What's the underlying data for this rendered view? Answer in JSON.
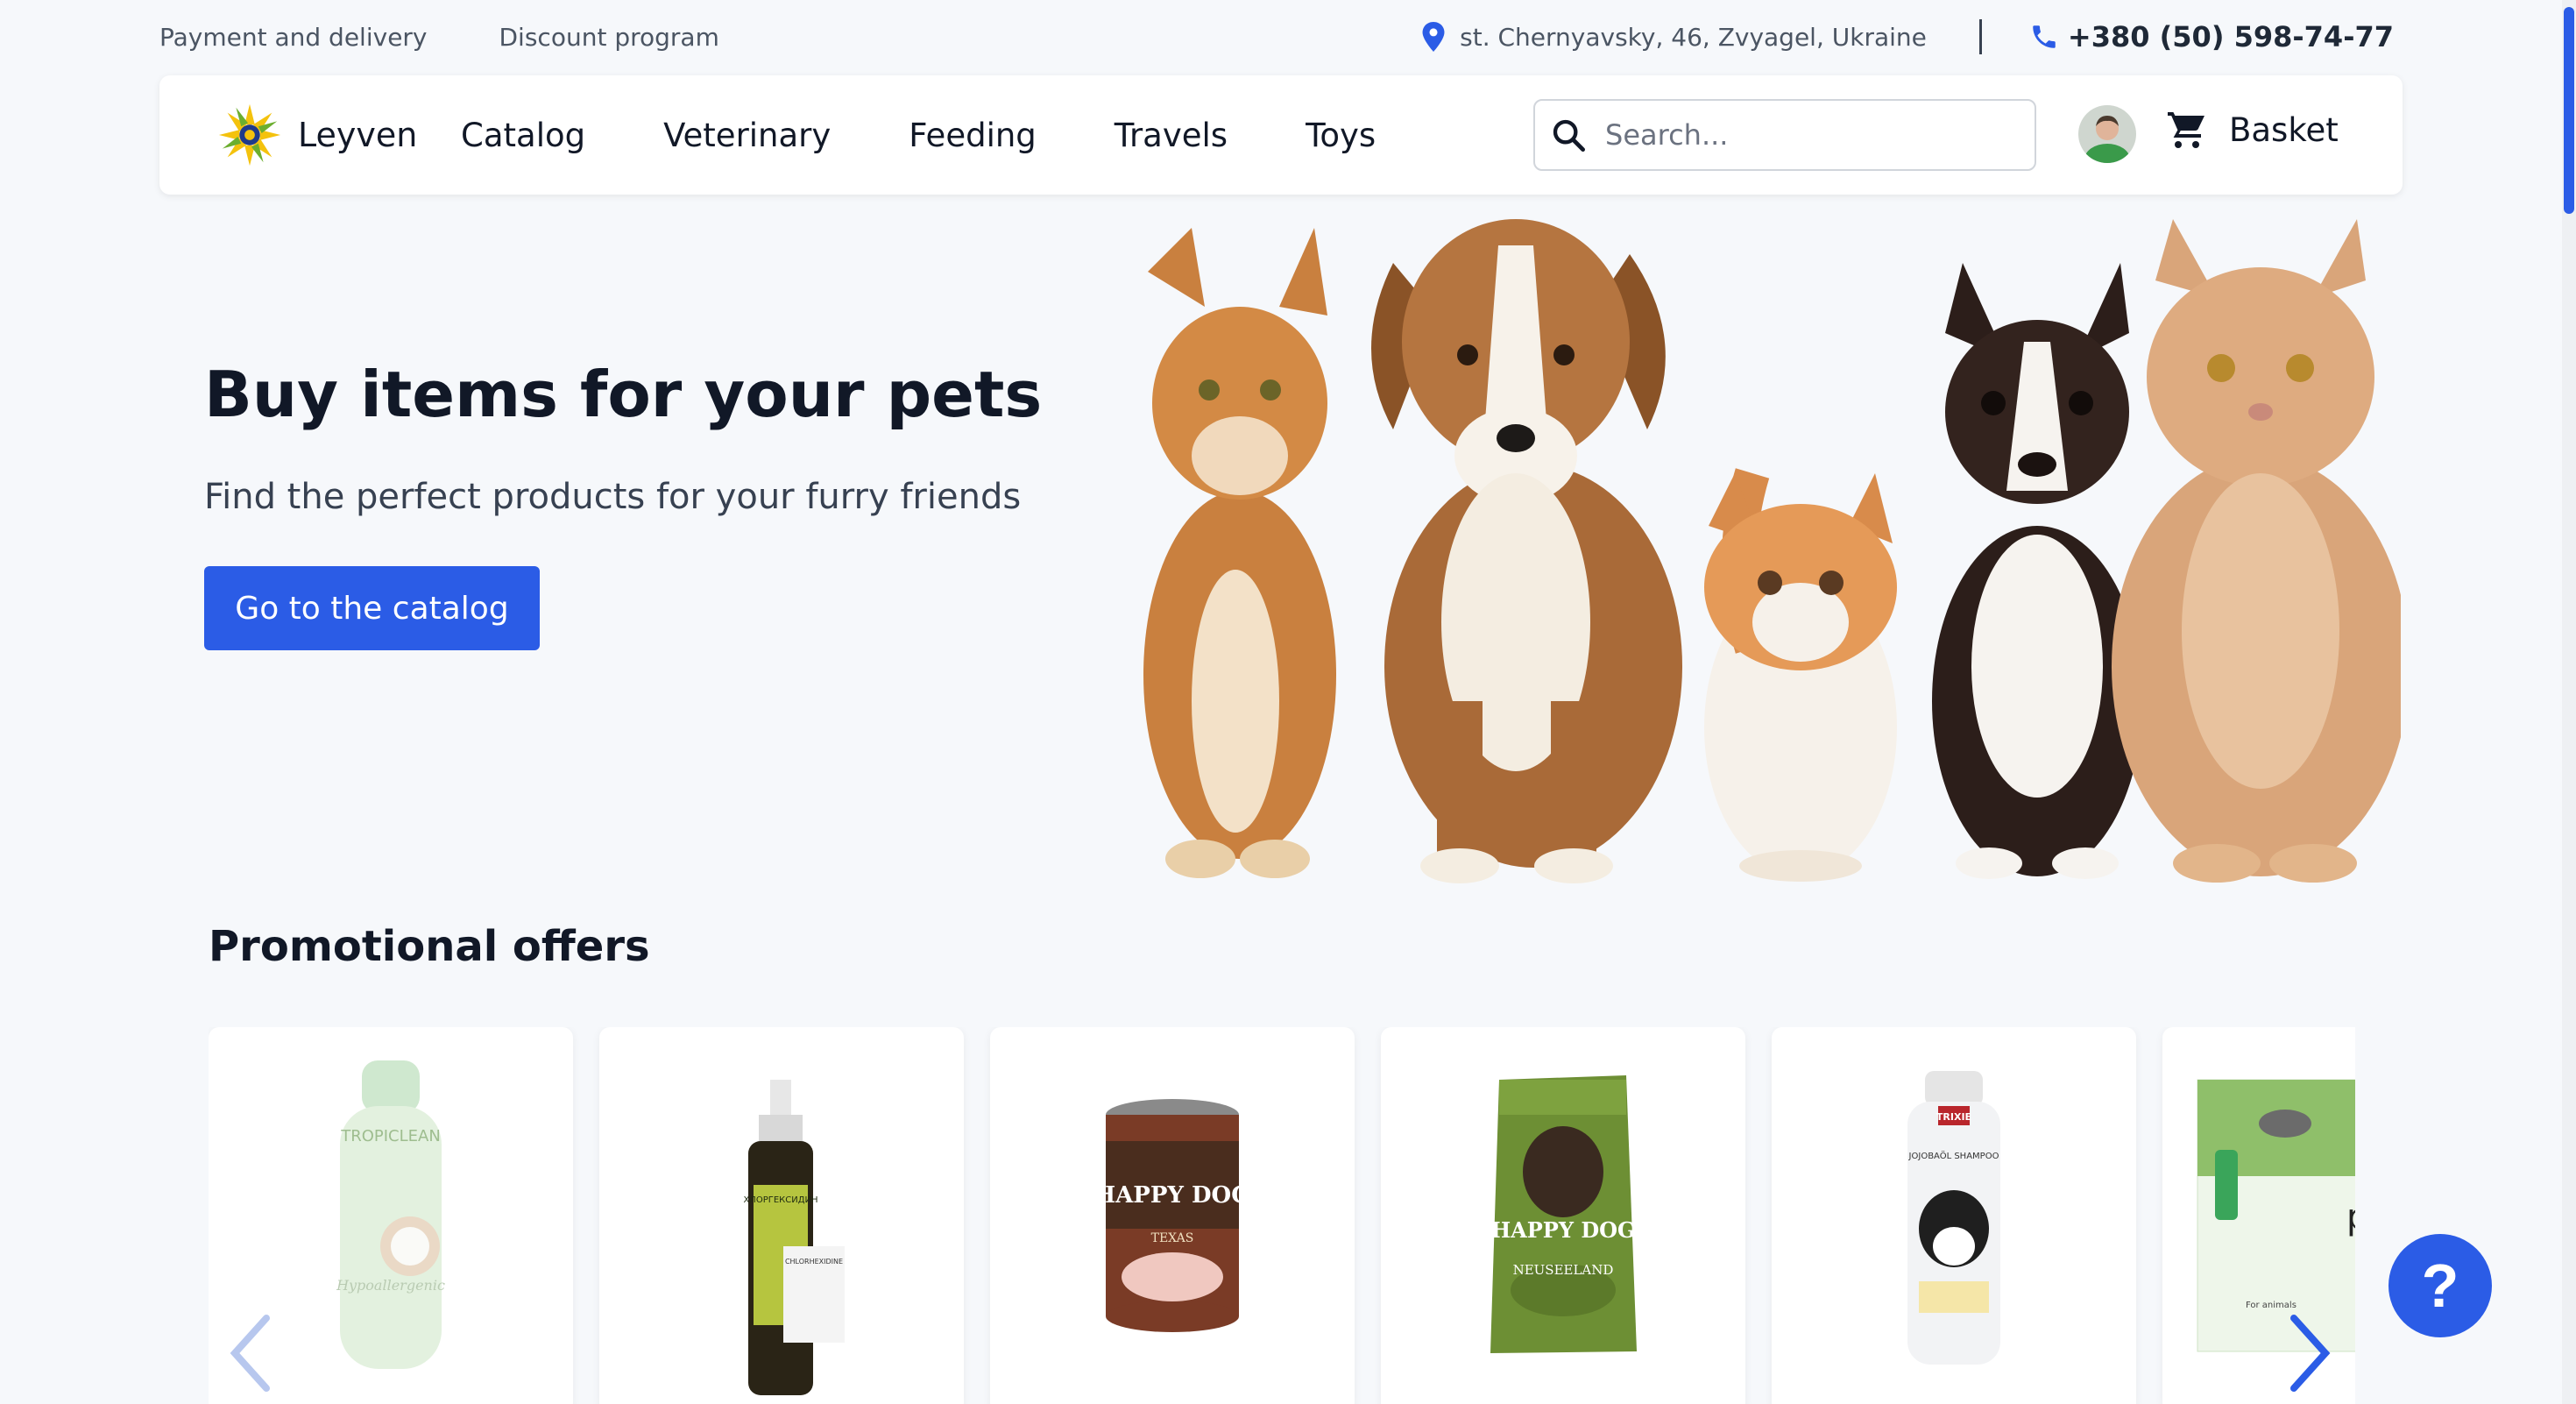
{
  "topbar": {
    "links": [
      "Payment and delivery",
      "Discount program"
    ],
    "address": "st. Chernyavsky, 46, Zvyagel, Ukraine",
    "phone": "+380 (50) 598-74-77"
  },
  "navbar": {
    "brand": "Leyven",
    "menu": [
      "Catalog",
      "Veterinary",
      "Feeding",
      "Travels",
      "Toys"
    ],
    "search_placeholder": "Search...",
    "basket_label": "Basket"
  },
  "hero": {
    "title": "Buy items for your pets",
    "subtitle": "Find the perfect products for your furry friends",
    "cta_label": "Go to the catalog"
  },
  "promo": {
    "title": "Promotional offers",
    "products": [
      {
        "brand": "TROPICLEAN",
        "line": "Hypoallergenic"
      },
      {
        "brand": "ХЛОРГЕКСИДИН",
        "line": "CHLORHEXIDINE"
      },
      {
        "brand": "HAPPY DOG",
        "line": "TEXAS"
      },
      {
        "brand": "HAPPY DOG",
        "line": "NEUSEELAND"
      },
      {
        "brand": "TRIXIE",
        "line": "JOJOBAÖL SHAMPOO"
      },
      {
        "brand": "pro",
        "line": "For animals"
      }
    ]
  },
  "help_label": "?",
  "colors": {
    "accent": "#2b5ce6",
    "background": "#f6f8fb"
  }
}
